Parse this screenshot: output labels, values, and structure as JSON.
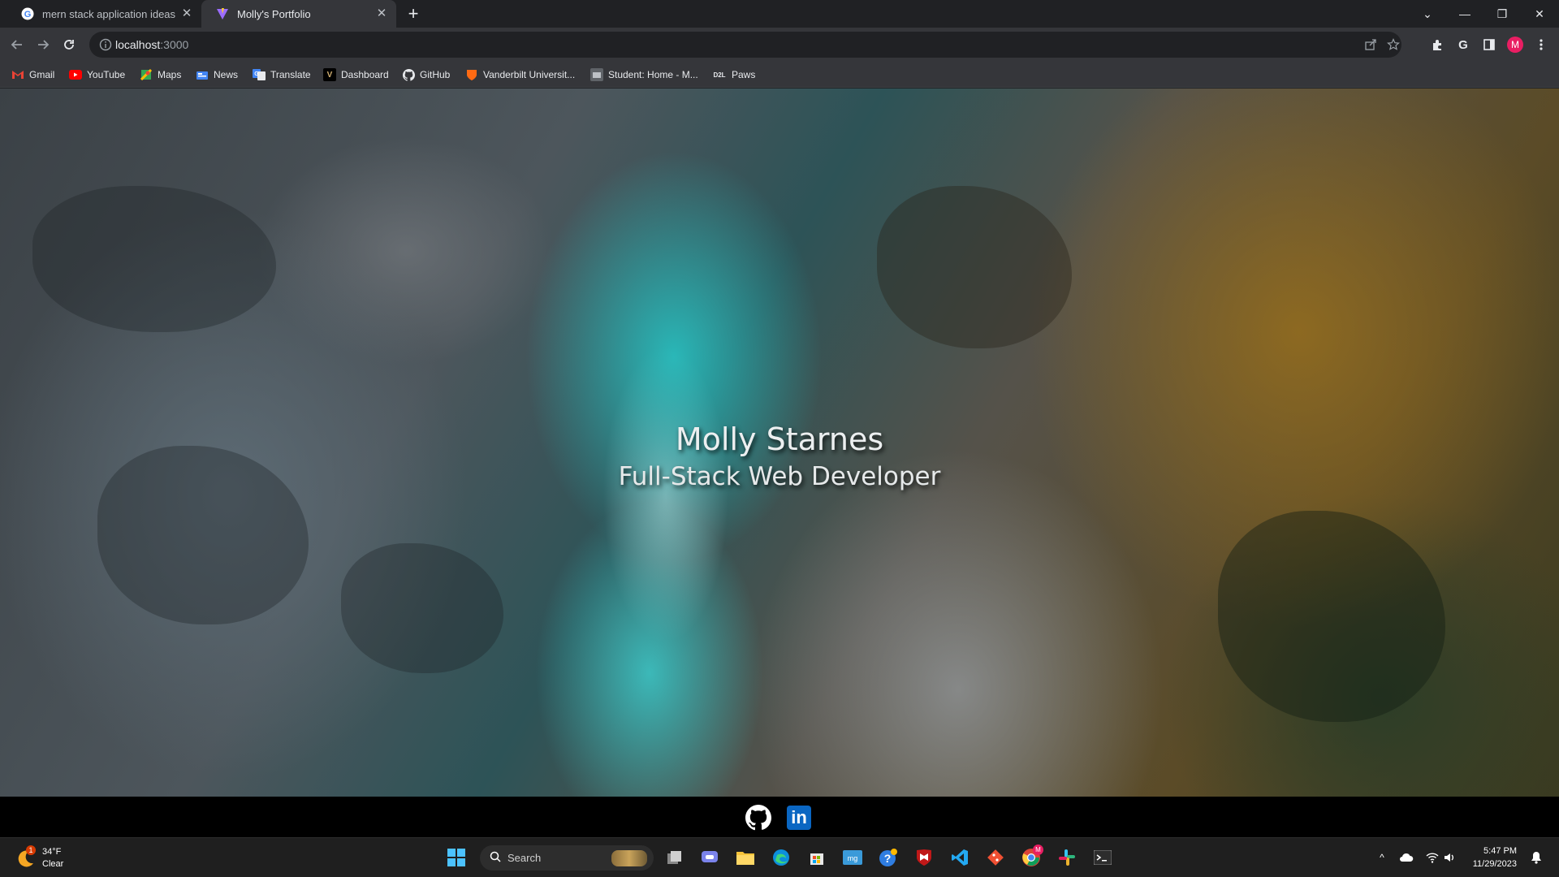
{
  "browser": {
    "tabs": [
      {
        "title": "mern stack application ideas - G",
        "active": false,
        "favicon": "google-icon"
      },
      {
        "title": "Molly's Portfolio",
        "active": true,
        "favicon": "vite-icon"
      }
    ],
    "new_tab_label": "+",
    "address": {
      "host": "localhost",
      "port": ":3000"
    },
    "profile_initial": "M",
    "bookmarks": [
      {
        "label": "Gmail",
        "icon": "gmail-icon"
      },
      {
        "label": "YouTube",
        "icon": "youtube-icon"
      },
      {
        "label": "Maps",
        "icon": "maps-icon"
      },
      {
        "label": "News",
        "icon": "news-icon"
      },
      {
        "label": "Translate",
        "icon": "translate-icon"
      },
      {
        "label": "Dashboard",
        "icon": "vanderbilt-icon"
      },
      {
        "label": "GitHub",
        "icon": "github-icon"
      },
      {
        "label": "Vanderbilt Universit...",
        "icon": "vanderbilt-shield-icon"
      },
      {
        "label": "Student: Home - M...",
        "icon": "student-icon"
      },
      {
        "label": "Paws",
        "icon": "paws-icon"
      }
    ]
  },
  "page": {
    "name": "Molly Starnes",
    "subtitle": "Full-Stack Web Developer",
    "social": [
      "github-icon",
      "linkedin-icon"
    ],
    "linkedin_text": "in"
  },
  "taskbar": {
    "weather": {
      "temp": "34°F",
      "condition": "Clear",
      "badge": "1"
    },
    "search_label": "Search",
    "clock": {
      "time": "5:47 PM",
      "date": "11/29/2023"
    },
    "chrome_badge": "M"
  },
  "colors": {
    "accent_profile": "#e91e63",
    "page_footer": "#000000",
    "taskbar": "#1f1f1f"
  }
}
